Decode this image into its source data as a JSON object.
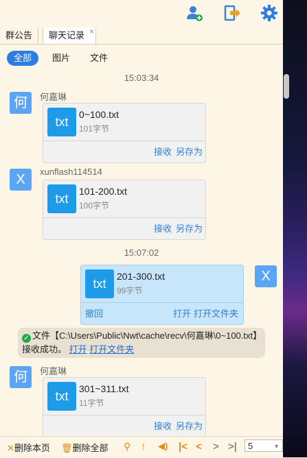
{
  "toolbar": {
    "icons": [
      "add-user-icon",
      "exit-icon",
      "gear-icon"
    ]
  },
  "tabs": [
    {
      "label": "群公告"
    },
    {
      "label": "聊天记录"
    }
  ],
  "tab_close": "×",
  "filters": [
    "全部",
    "图片",
    "文件"
  ],
  "messages": [
    {
      "time": "15:03:34"
    },
    {
      "avatar": "何",
      "sender": "何嘉琳",
      "file": "0~100.txt",
      "size": "101字节",
      "actions": [
        "接收",
        "另存为"
      ]
    },
    {
      "avatar": "X",
      "sender": "xunflash114514",
      "file": "101-200.txt",
      "size": "100字节",
      "actions": [
        "接收",
        "另存为"
      ]
    },
    {
      "time": "15:07:02"
    },
    {
      "avatar": "X",
      "file": "201-300.txt",
      "size": "99字节",
      "actions_left": [
        "撤回"
      ],
      "actions": [
        "打开",
        "打开文件夹"
      ]
    },
    {
      "notice_text": "文件【C:\\Users\\Public\\Nwt\\cache\\recv\\何嘉琳\\0~100.txt】接收成功。",
      "notice_links": [
        "打开",
        "打开文件夹"
      ]
    },
    {
      "avatar": "何",
      "sender": "何嘉琳",
      "file": "301~311.txt",
      "size": "11字节",
      "actions": [
        "接收",
        "另存为"
      ]
    }
  ],
  "file_icon_label": "txt",
  "bottom": {
    "delete_page": "删除本页",
    "delete_all": "删除全部",
    "page_select": "5"
  },
  "colors": {
    "accent": "#2d7de0",
    "file_icon": "#1d9be8",
    "avatar": "#5aa6f5",
    "link": "#3080d8",
    "nav": "#e38b12"
  }
}
